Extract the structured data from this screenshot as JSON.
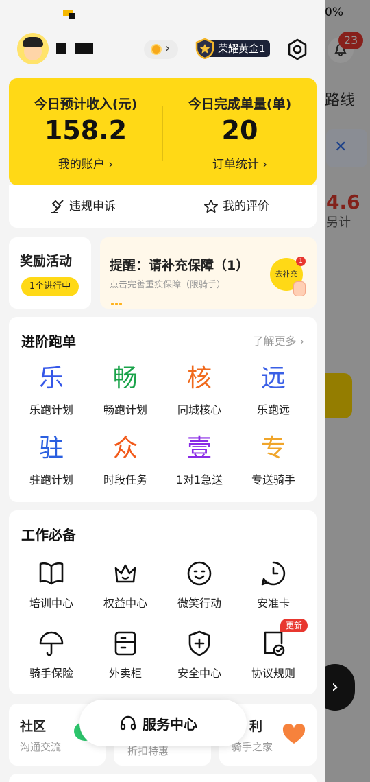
{
  "background_app": {
    "battery_text": "0%",
    "notification_count": "23",
    "title_fragment": "路线",
    "red_value_fragment": "4.6",
    "sub_fragment": "另计"
  },
  "profile": {
    "rank_name": "荣耀黄金1"
  },
  "income": {
    "income_label": "今日预计收入(元)",
    "income_value": "158.2",
    "account_link": "我的账户",
    "orders_label": "今日完成单量(单)",
    "orders_value": "20",
    "orders_link": "订单统计",
    "chevron": "›"
  },
  "actions": {
    "appeal": "违规申诉",
    "rating": "我的评价"
  },
  "reward": {
    "title": "奖励活动",
    "badge": "1个进行中"
  },
  "reminder": {
    "title": "提醒：请补充保障（1）",
    "subtitle": "点击完善重疾保障（限骑手）",
    "button": "去补充",
    "button_badge": "1"
  },
  "advanced": {
    "title": "进阶跑单",
    "more": "了解更多",
    "more_chevron": "›",
    "items": [
      {
        "glyph": "乐",
        "label": "乐跑计划",
        "color": "#3557e8"
      },
      {
        "glyph": "畅",
        "label": "畅跑计划",
        "color": "#1aa34a"
      },
      {
        "glyph": "核",
        "label": "同城核心",
        "color": "#f06a1d"
      },
      {
        "glyph": "远",
        "label": "乐跑远",
        "color": "#3a5fe6"
      },
      {
        "glyph": "驻",
        "label": "驻跑计划",
        "color": "#2a5fe0"
      },
      {
        "glyph": "众",
        "label": "时段任务",
        "color": "#f25a1a"
      },
      {
        "glyph": "壹",
        "label": "1对1急送",
        "color": "#8a2be6"
      },
      {
        "glyph": "专",
        "label": "专送骑手",
        "color": "#f0a52a"
      }
    ]
  },
  "work": {
    "title": "工作必备",
    "items": [
      {
        "icon": "book-icon",
        "label": "培训中心"
      },
      {
        "icon": "crown-icon",
        "label": "权益中心"
      },
      {
        "icon": "smile-icon",
        "label": "微笑行动"
      },
      {
        "icon": "clock-card-icon",
        "label": "安准卡"
      },
      {
        "icon": "umbrella-icon",
        "label": "骑手保险"
      },
      {
        "icon": "cabinet-icon",
        "label": "外卖柜"
      },
      {
        "icon": "shield-plus-icon",
        "label": "安全中心"
      },
      {
        "icon": "document-check-icon",
        "label": "协议规则"
      }
    ],
    "new_badge": "更新"
  },
  "bottom": {
    "community_title": "社区",
    "community_sub": "沟通交流",
    "middle_sub": "折扣特惠",
    "welfare_title": "利",
    "welfare_sub": "骑手之家",
    "service_center": "服务中心"
  }
}
